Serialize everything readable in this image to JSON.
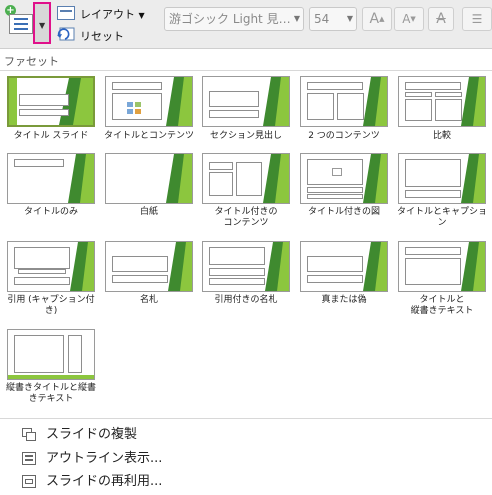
{
  "toolbar": {
    "layout_label": "レイアウト",
    "reset_label": "リセット",
    "font_name": "游ゴシック Light 見…",
    "font_size": "54",
    "grow_font": "A",
    "shrink_font": "A",
    "clear_format": "A"
  },
  "panel": {
    "title": "ファセット"
  },
  "layouts": [
    {
      "label": "タイトル スライド"
    },
    {
      "label": "タイトルとコンテンツ"
    },
    {
      "label": "セクション見出し"
    },
    {
      "label": "2 つのコンテンツ"
    },
    {
      "label": "比較"
    },
    {
      "label": "タイトルのみ"
    },
    {
      "label": "白紙"
    },
    {
      "label": "タイトル付きの\nコンテンツ"
    },
    {
      "label": "タイトル付きの図"
    },
    {
      "label": "タイトルとキャプショ\nン"
    },
    {
      "label": "引用 (キャプション付\nき)"
    },
    {
      "label": "名札"
    },
    {
      "label": "引用付きの名札"
    },
    {
      "label": "真または偽"
    },
    {
      "label": "タイトルと\n縦書きテキスト"
    },
    {
      "label": "縦書きタイトルと縦書\nきテキスト"
    }
  ],
  "menu": [
    {
      "label": "スライドの複製"
    },
    {
      "label": "アウトライン表示..."
    },
    {
      "label": "スライドの再利用..."
    }
  ],
  "colors": {
    "accent_green": "#8cc63e",
    "dark_green": "#3f8a2f",
    "highlight_pink": "#e0108a"
  }
}
